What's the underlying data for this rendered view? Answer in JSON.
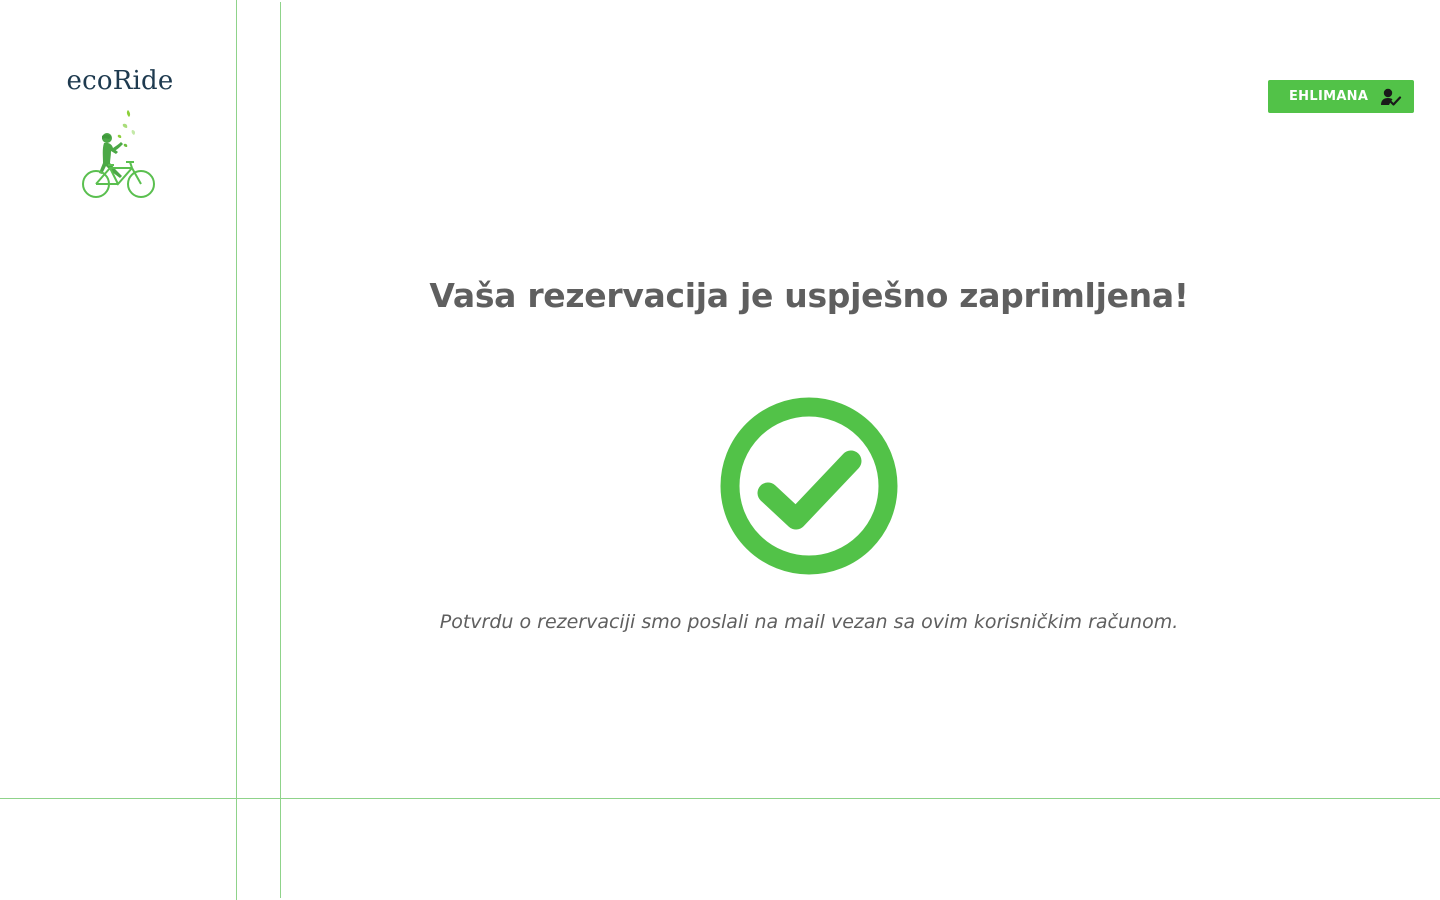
{
  "brand": {
    "name": "ecoRide",
    "logo_icon": "cyclist-logo-icon",
    "text_color": "#1e3a4f",
    "accent_color": "#52c248"
  },
  "header": {
    "user_button_label": "EHLIMANA",
    "user_button_icon": "user-check-icon",
    "user_button_color": "#52c248"
  },
  "main": {
    "title": "Vaša rezervacija je uspješno zaprimljena!",
    "status_icon": "check-circle-icon",
    "status_color": "#52c248",
    "message": "Potvrdu o rezervaciji smo poslali na mail vezan sa ovim korisničkim računom."
  },
  "theme": {
    "guide_line_color": "#8fd38a",
    "text_color": "#5f5f5f"
  }
}
